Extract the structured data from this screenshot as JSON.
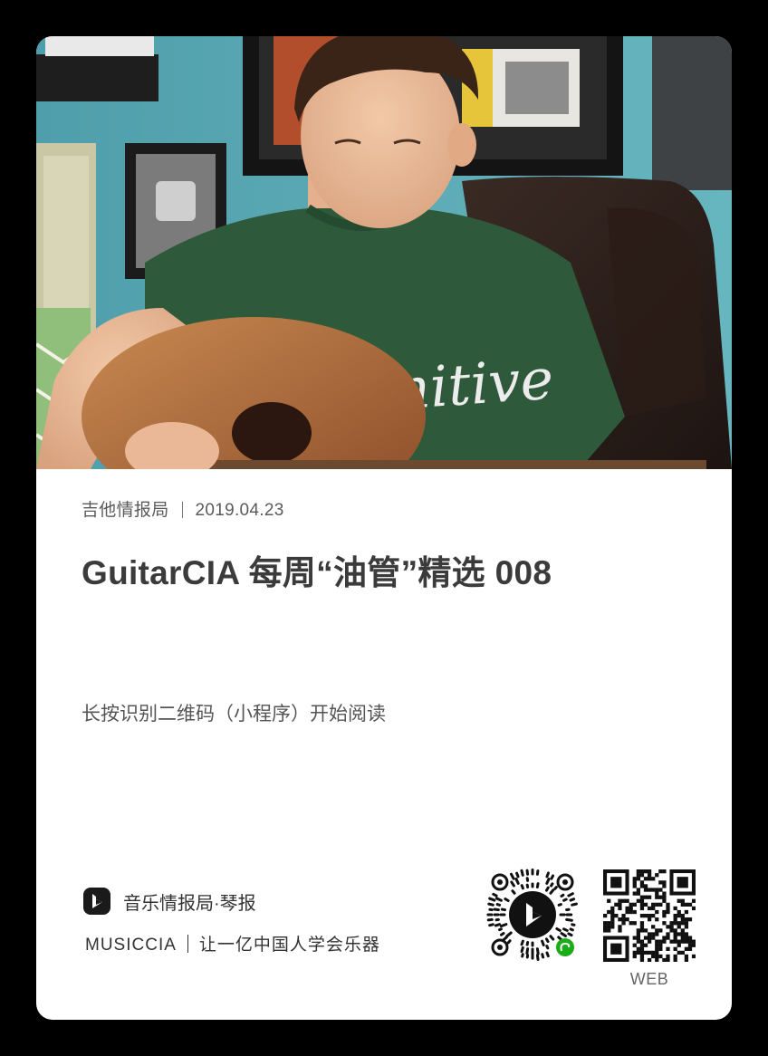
{
  "post": {
    "source": "吉他情报局",
    "date": "2019.04.23",
    "title": "GuitarCIA 每周“油管”精选 008",
    "shirt_text": "Primitive"
  },
  "instruction": "长按识别二维码（小程序）开始阅读",
  "brand": {
    "name": "音乐情报局·琴报",
    "latin": "MUSICCIA",
    "slogan": "让一亿中国人学会乐器"
  },
  "qr": {
    "web_label": "WEB"
  },
  "colors": {
    "card_bg": "#ffffff",
    "page_bg": "#000000",
    "title": "#3b3b3b",
    "meta": "#5a5a5a",
    "shirt": "#2e5a3b",
    "wall": "#5aa9b3",
    "miniprogram_badge": "#1aad19"
  }
}
